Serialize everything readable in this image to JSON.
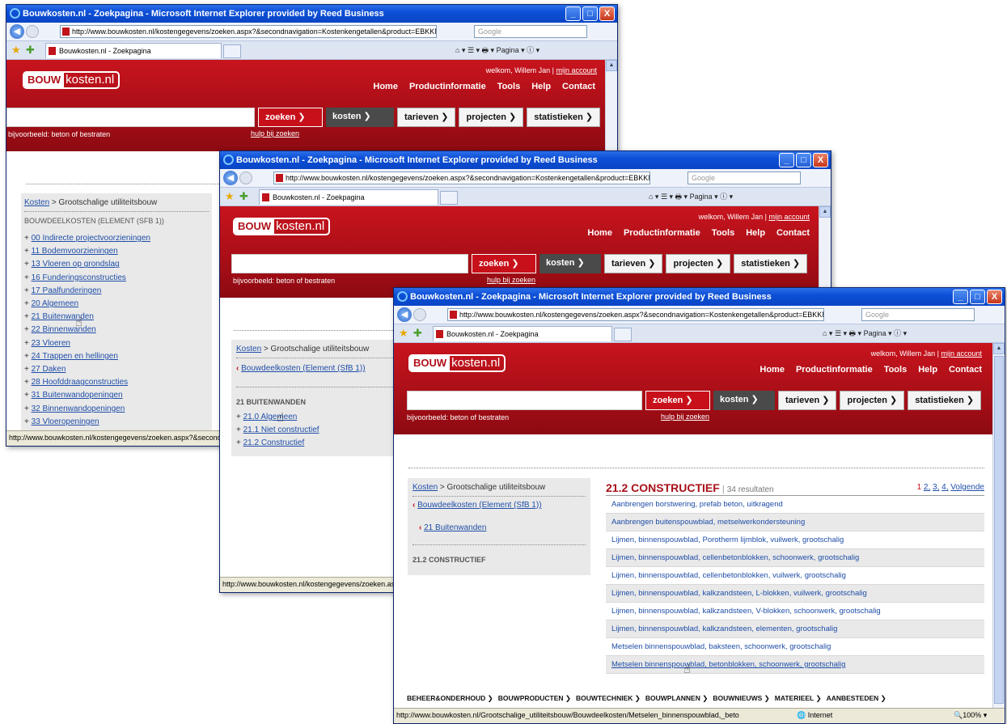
{
  "browser": {
    "title": "Bouwkosten.nl - Zoekpagina - Microsoft Internet Explorer provided by Reed Business",
    "url1": "http://www.bouwkosten.nl/kostengegevens/zoeken.aspx?&secondnavigation=Kostenkengetallen&product=EBKKNB&tabeld",
    "url2": "http://www.bouwkosten.nl/kostengegevens/zoeken.aspx?&secondnavigation=Kostenkengetallen&product=EBKKNB&tabe",
    "url3": "http://www.bouwkosten.nl/kostengegevens/zoeken.aspx?&secondnavigation=Kostenkengetallen&product=EBKKNB&tabe",
    "search_placeholder": "Google",
    "tab_label": "Bouwkosten.nl - Zoekpagina",
    "tools_label": "Pagina",
    "minimize": "_",
    "maximize": "□",
    "close": "X",
    "status1": "http://www.bouwkosten.nl/kostengegevens/zoeken.aspx?&secondnavig",
    "status2": "http://www.bouwkosten.nl/kostengegevens/zoeken.aspx?&",
    "status3": "http://www.bouwkosten.nl/Grootschalige_utiliteitsbouw/Bouwdeelkosten/Metselen_binnenspouwblad,_beto",
    "status_zone": "Internet",
    "status_zoom": "100%"
  },
  "site": {
    "logo_left": "BOUW",
    "logo_right": "kosten.nl",
    "welcome": "welkom, Willem Jan |",
    "account": "mijn account",
    "nav": [
      "Home",
      "Productinformatie",
      "Tools",
      "Help",
      "Contact"
    ],
    "search_button": "zoeken",
    "btn_kosten": "kosten",
    "btn_tarieven": "tarieven",
    "btn_projecten": "projecten",
    "btn_statistieken": "statistieken",
    "example": "bijvoorbeeld: beton of bestraten",
    "help_link": "hulp bij zoeken"
  },
  "window1": {
    "crumb_link": "Kosten",
    "crumb_rest": " > Grootschalige utiliteitsbouw",
    "section": "BOUWDEELKOSTEN (ELEMENT (SFB 1))",
    "items": [
      "00 Indirecte projectvoorzieningen",
      "11 Bodemvoorzieningen",
      "13 Vloeren op grondslag",
      "16 Funderingsconstructies",
      "17 Paalfunderingen",
      "20 Algemeen",
      "21 Buitenwanden",
      "22 Binnenwanden",
      "23 Vloeren",
      "24 Trappen en hellingen",
      "27 Daken",
      "28 Hoofddraagconstructies",
      "31 Buitenwandopeningen",
      "32 Binnenwandopeningen",
      "33 Vloeropeningen"
    ]
  },
  "window2": {
    "crumb_link": "Kosten",
    "crumb_rest": " > Grootschalige utiliteitsbouw",
    "back_link": "Bouwdeelkosten (Element (SfB 1))",
    "section": "21 BUITENWANDEN",
    "items": [
      "21.0 Algemeen",
      "21.1 Niet constructief",
      "21.2 Constructief"
    ]
  },
  "window3": {
    "crumb_link": "Kosten",
    "crumb_rest": " > Grootschalige utiliteitsbouw",
    "back_link1": "Bouwdeelkosten (Element (SfB 1))",
    "back_link2": "21 Buitenwanden",
    "section": "21.2 CONSTRUCTIEF",
    "result_title": "21.2 CONSTRUCTIEF",
    "result_count": "34 resultaten",
    "pagination_current": "1",
    "pages": [
      "2",
      "3",
      "4"
    ],
    "next": "Volgende",
    "results": [
      "Aanbrengen borstwering, prefab beton, uitkragend",
      "Aanbrengen buitenspouwblad, metselwerkondersteuning",
      "Lijmen, binnenspouwblad, Porotherm lijmblok, vuilwerk, grootschalig",
      "Lijmen, binnenspouwblad, cellenbetonblokken, schoonwerk, grootschalig",
      "Lijmen, binnenspouwblad, cellenbetonblokken, vuilwerk, grootschalig",
      "Lijmen, binnenspouwblad, kalkzandsteen, L-blokken, vuilwerk, grootschalig",
      "Lijmen, binnenspouwblad, kalkzandsteen, V-blokken, schoonwerk, grootschalig",
      "Lijmen, binnenspouwblad, kalkzandsteen, elementen, grootschalig",
      "Metselen binnenspouwblad, baksteen, schoonwerk, grootschalig",
      "Metselen binnenspouwblad, betonblokken, schoonwerk, grootschalig"
    ],
    "footer_nav": [
      "BEHEER&ONDERHOUD",
      "BOUWPRODUCTEN",
      "BOUWTECHNIEK",
      "BOUWPLANNEN",
      "BOUWNIEUWS",
      "MATERIEEL",
      "AANBESTEDEN"
    ]
  }
}
